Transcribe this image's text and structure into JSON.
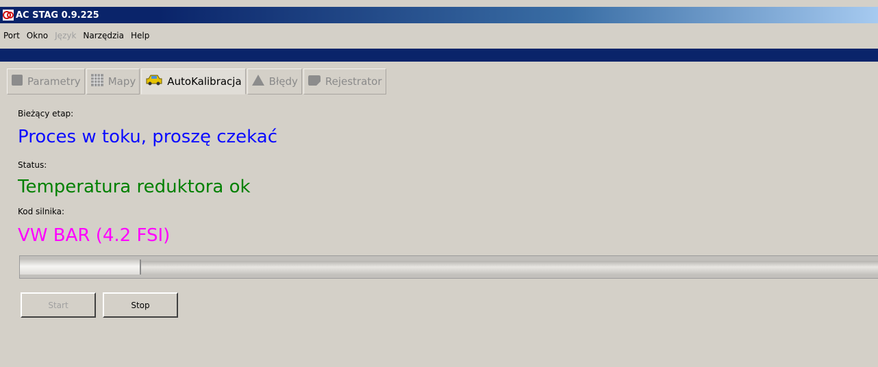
{
  "window": {
    "title": "AC STAG 0.9.225"
  },
  "menu": [
    {
      "label": "Port",
      "disabled": false
    },
    {
      "label": "Okno",
      "disabled": false
    },
    {
      "label": "Język",
      "disabled": true
    },
    {
      "label": "Narzędzia",
      "disabled": false
    },
    {
      "label": "Help",
      "disabled": false
    }
  ],
  "tabs": [
    {
      "label": "Parametry",
      "icon": "parameters-icon",
      "active": false
    },
    {
      "label": "Mapy",
      "icon": "map-grid-icon",
      "active": false
    },
    {
      "label": "AutoKalibracja",
      "icon": "car-icon",
      "active": true
    },
    {
      "label": "Błędy",
      "icon": "warning-triangle-icon",
      "active": false
    },
    {
      "label": "Rejestrator",
      "icon": "recorder-icon",
      "active": false
    }
  ],
  "calibration": {
    "stage_label": "Bieżący etap:",
    "stage_value": "Proces w toku, proszę czekać",
    "status_label": "Status:",
    "status_value": "Temperatura reduktora ok",
    "engine_label": "Kod silnika:",
    "engine_value": "VW BAR (4.2 FSI)",
    "progress_fraction": 0.14
  },
  "buttons": {
    "start_label": "Start",
    "stop_label": "Stop"
  },
  "colors": {
    "stage": "#0b0bff",
    "status": "#008000",
    "engine": "#ff00ff",
    "titlebar": "#0a246a"
  }
}
